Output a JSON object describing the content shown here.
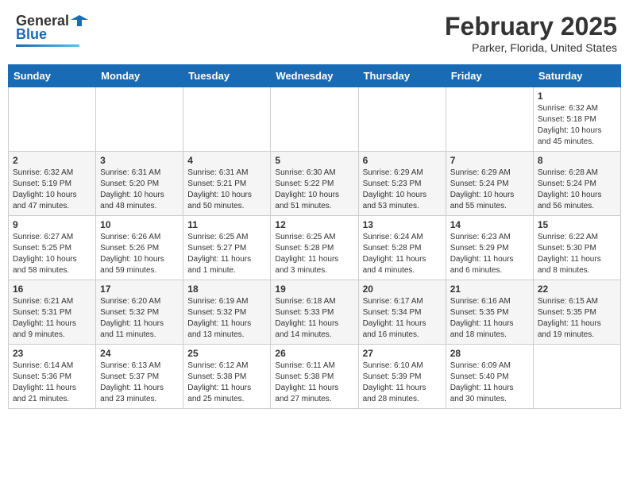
{
  "header": {
    "logo_general": "General",
    "logo_blue": "Blue",
    "month_title": "February 2025",
    "location": "Parker, Florida, United States"
  },
  "weekdays": [
    "Sunday",
    "Monday",
    "Tuesday",
    "Wednesday",
    "Thursday",
    "Friday",
    "Saturday"
  ],
  "weeks": [
    [
      {
        "day": "",
        "info": ""
      },
      {
        "day": "",
        "info": ""
      },
      {
        "day": "",
        "info": ""
      },
      {
        "day": "",
        "info": ""
      },
      {
        "day": "",
        "info": ""
      },
      {
        "day": "",
        "info": ""
      },
      {
        "day": "1",
        "info": "Sunrise: 6:32 AM\nSunset: 5:18 PM\nDaylight: 10 hours and 45 minutes."
      }
    ],
    [
      {
        "day": "2",
        "info": "Sunrise: 6:32 AM\nSunset: 5:19 PM\nDaylight: 10 hours and 47 minutes."
      },
      {
        "day": "3",
        "info": "Sunrise: 6:31 AM\nSunset: 5:20 PM\nDaylight: 10 hours and 48 minutes."
      },
      {
        "day": "4",
        "info": "Sunrise: 6:31 AM\nSunset: 5:21 PM\nDaylight: 10 hours and 50 minutes."
      },
      {
        "day": "5",
        "info": "Sunrise: 6:30 AM\nSunset: 5:22 PM\nDaylight: 10 hours and 51 minutes."
      },
      {
        "day": "6",
        "info": "Sunrise: 6:29 AM\nSunset: 5:23 PM\nDaylight: 10 hours and 53 minutes."
      },
      {
        "day": "7",
        "info": "Sunrise: 6:29 AM\nSunset: 5:24 PM\nDaylight: 10 hours and 55 minutes."
      },
      {
        "day": "8",
        "info": "Sunrise: 6:28 AM\nSunset: 5:24 PM\nDaylight: 10 hours and 56 minutes."
      }
    ],
    [
      {
        "day": "9",
        "info": "Sunrise: 6:27 AM\nSunset: 5:25 PM\nDaylight: 10 hours and 58 minutes."
      },
      {
        "day": "10",
        "info": "Sunrise: 6:26 AM\nSunset: 5:26 PM\nDaylight: 10 hours and 59 minutes."
      },
      {
        "day": "11",
        "info": "Sunrise: 6:25 AM\nSunset: 5:27 PM\nDaylight: 11 hours and 1 minute."
      },
      {
        "day": "12",
        "info": "Sunrise: 6:25 AM\nSunset: 5:28 PM\nDaylight: 11 hours and 3 minutes."
      },
      {
        "day": "13",
        "info": "Sunrise: 6:24 AM\nSunset: 5:28 PM\nDaylight: 11 hours and 4 minutes."
      },
      {
        "day": "14",
        "info": "Sunrise: 6:23 AM\nSunset: 5:29 PM\nDaylight: 11 hours and 6 minutes."
      },
      {
        "day": "15",
        "info": "Sunrise: 6:22 AM\nSunset: 5:30 PM\nDaylight: 11 hours and 8 minutes."
      }
    ],
    [
      {
        "day": "16",
        "info": "Sunrise: 6:21 AM\nSunset: 5:31 PM\nDaylight: 11 hours and 9 minutes."
      },
      {
        "day": "17",
        "info": "Sunrise: 6:20 AM\nSunset: 5:32 PM\nDaylight: 11 hours and 11 minutes."
      },
      {
        "day": "18",
        "info": "Sunrise: 6:19 AM\nSunset: 5:32 PM\nDaylight: 11 hours and 13 minutes."
      },
      {
        "day": "19",
        "info": "Sunrise: 6:18 AM\nSunset: 5:33 PM\nDaylight: 11 hours and 14 minutes."
      },
      {
        "day": "20",
        "info": "Sunrise: 6:17 AM\nSunset: 5:34 PM\nDaylight: 11 hours and 16 minutes."
      },
      {
        "day": "21",
        "info": "Sunrise: 6:16 AM\nSunset: 5:35 PM\nDaylight: 11 hours and 18 minutes."
      },
      {
        "day": "22",
        "info": "Sunrise: 6:15 AM\nSunset: 5:35 PM\nDaylight: 11 hours and 19 minutes."
      }
    ],
    [
      {
        "day": "23",
        "info": "Sunrise: 6:14 AM\nSunset: 5:36 PM\nDaylight: 11 hours and 21 minutes."
      },
      {
        "day": "24",
        "info": "Sunrise: 6:13 AM\nSunset: 5:37 PM\nDaylight: 11 hours and 23 minutes."
      },
      {
        "day": "25",
        "info": "Sunrise: 6:12 AM\nSunset: 5:38 PM\nDaylight: 11 hours and 25 minutes."
      },
      {
        "day": "26",
        "info": "Sunrise: 6:11 AM\nSunset: 5:38 PM\nDaylight: 11 hours and 27 minutes."
      },
      {
        "day": "27",
        "info": "Sunrise: 6:10 AM\nSunset: 5:39 PM\nDaylight: 11 hours and 28 minutes."
      },
      {
        "day": "28",
        "info": "Sunrise: 6:09 AM\nSunset: 5:40 PM\nDaylight: 11 hours and 30 minutes."
      },
      {
        "day": "",
        "info": ""
      }
    ]
  ]
}
